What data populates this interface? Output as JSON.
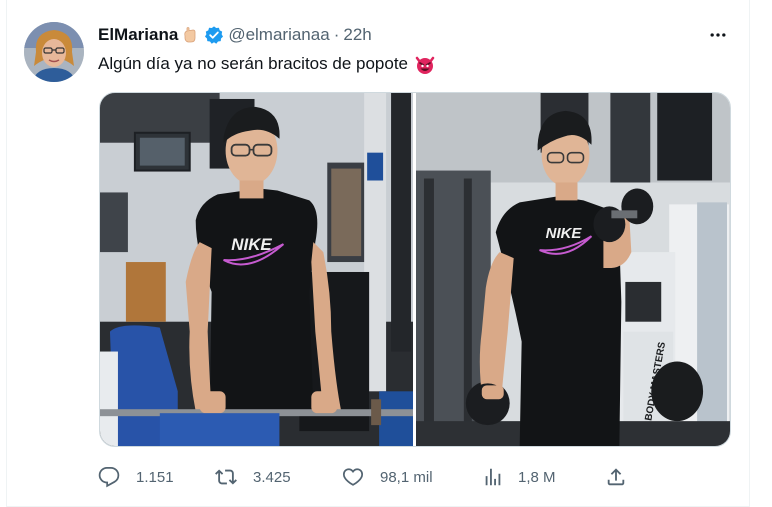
{
  "tweet": {
    "author": {
      "display_name": "ElMariana",
      "handle": "@elmarianaa",
      "verified": true,
      "name_emoji_icon": "hand-gesture-emoji-icon"
    },
    "separator": "·",
    "timestamp": "22h",
    "text": "Algún día ya no serán bracitos de popote",
    "text_emoji_icon": "devil-face-emoji-icon",
    "media": {
      "count": 2,
      "photo_1_shirt_logo": "NIKE",
      "photo_2_shirt_logo": "NIKE",
      "photo_2_bench_label": "BODY MASTERS"
    },
    "stats": {
      "replies": "1.151",
      "retweets": "3.425",
      "likes": "98,1 mil",
      "views": "1,8 M"
    },
    "colors": {
      "verified_blue": "#1d9bf0",
      "secondary_text": "#536471",
      "primary_text": "#0f1419"
    }
  }
}
